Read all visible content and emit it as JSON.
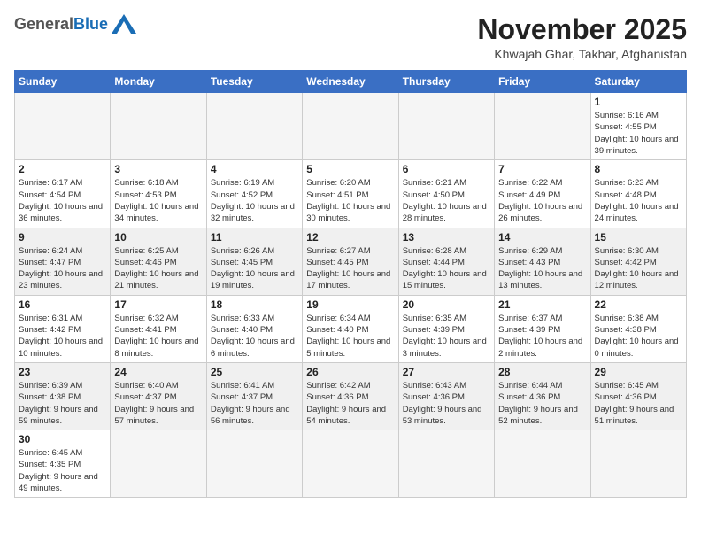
{
  "logo": {
    "general": "General",
    "blue": "Blue"
  },
  "header": {
    "month": "November 2025",
    "location": "Khwajah Ghar, Takhar, Afghanistan"
  },
  "weekdays": [
    "Sunday",
    "Monday",
    "Tuesday",
    "Wednesday",
    "Thursday",
    "Friday",
    "Saturday"
  ],
  "days": [
    {
      "date": "",
      "info": ""
    },
    {
      "date": "",
      "info": ""
    },
    {
      "date": "",
      "info": ""
    },
    {
      "date": "",
      "info": ""
    },
    {
      "date": "",
      "info": ""
    },
    {
      "date": "",
      "info": ""
    },
    {
      "date": "1",
      "info": "Sunrise: 6:16 AM\nSunset: 4:55 PM\nDaylight: 10 hours and 39 minutes."
    },
    {
      "date": "2",
      "info": "Sunrise: 6:17 AM\nSunset: 4:54 PM\nDaylight: 10 hours and 36 minutes."
    },
    {
      "date": "3",
      "info": "Sunrise: 6:18 AM\nSunset: 4:53 PM\nDaylight: 10 hours and 34 minutes."
    },
    {
      "date": "4",
      "info": "Sunrise: 6:19 AM\nSunset: 4:52 PM\nDaylight: 10 hours and 32 minutes."
    },
    {
      "date": "5",
      "info": "Sunrise: 6:20 AM\nSunset: 4:51 PM\nDaylight: 10 hours and 30 minutes."
    },
    {
      "date": "6",
      "info": "Sunrise: 6:21 AM\nSunset: 4:50 PM\nDaylight: 10 hours and 28 minutes."
    },
    {
      "date": "7",
      "info": "Sunrise: 6:22 AM\nSunset: 4:49 PM\nDaylight: 10 hours and 26 minutes."
    },
    {
      "date": "8",
      "info": "Sunrise: 6:23 AM\nSunset: 4:48 PM\nDaylight: 10 hours and 24 minutes."
    },
    {
      "date": "9",
      "info": "Sunrise: 6:24 AM\nSunset: 4:47 PM\nDaylight: 10 hours and 23 minutes."
    },
    {
      "date": "10",
      "info": "Sunrise: 6:25 AM\nSunset: 4:46 PM\nDaylight: 10 hours and 21 minutes."
    },
    {
      "date": "11",
      "info": "Sunrise: 6:26 AM\nSunset: 4:45 PM\nDaylight: 10 hours and 19 minutes."
    },
    {
      "date": "12",
      "info": "Sunrise: 6:27 AM\nSunset: 4:45 PM\nDaylight: 10 hours and 17 minutes."
    },
    {
      "date": "13",
      "info": "Sunrise: 6:28 AM\nSunset: 4:44 PM\nDaylight: 10 hours and 15 minutes."
    },
    {
      "date": "14",
      "info": "Sunrise: 6:29 AM\nSunset: 4:43 PM\nDaylight: 10 hours and 13 minutes."
    },
    {
      "date": "15",
      "info": "Sunrise: 6:30 AM\nSunset: 4:42 PM\nDaylight: 10 hours and 12 minutes."
    },
    {
      "date": "16",
      "info": "Sunrise: 6:31 AM\nSunset: 4:42 PM\nDaylight: 10 hours and 10 minutes."
    },
    {
      "date": "17",
      "info": "Sunrise: 6:32 AM\nSunset: 4:41 PM\nDaylight: 10 hours and 8 minutes."
    },
    {
      "date": "18",
      "info": "Sunrise: 6:33 AM\nSunset: 4:40 PM\nDaylight: 10 hours and 6 minutes."
    },
    {
      "date": "19",
      "info": "Sunrise: 6:34 AM\nSunset: 4:40 PM\nDaylight: 10 hours and 5 minutes."
    },
    {
      "date": "20",
      "info": "Sunrise: 6:35 AM\nSunset: 4:39 PM\nDaylight: 10 hours and 3 minutes."
    },
    {
      "date": "21",
      "info": "Sunrise: 6:37 AM\nSunset: 4:39 PM\nDaylight: 10 hours and 2 minutes."
    },
    {
      "date": "22",
      "info": "Sunrise: 6:38 AM\nSunset: 4:38 PM\nDaylight: 10 hours and 0 minutes."
    },
    {
      "date": "23",
      "info": "Sunrise: 6:39 AM\nSunset: 4:38 PM\nDaylight: 9 hours and 59 minutes."
    },
    {
      "date": "24",
      "info": "Sunrise: 6:40 AM\nSunset: 4:37 PM\nDaylight: 9 hours and 57 minutes."
    },
    {
      "date": "25",
      "info": "Sunrise: 6:41 AM\nSunset: 4:37 PM\nDaylight: 9 hours and 56 minutes."
    },
    {
      "date": "26",
      "info": "Sunrise: 6:42 AM\nSunset: 4:36 PM\nDaylight: 9 hours and 54 minutes."
    },
    {
      "date": "27",
      "info": "Sunrise: 6:43 AM\nSunset: 4:36 PM\nDaylight: 9 hours and 53 minutes."
    },
    {
      "date": "28",
      "info": "Sunrise: 6:44 AM\nSunset: 4:36 PM\nDaylight: 9 hours and 52 minutes."
    },
    {
      "date": "29",
      "info": "Sunrise: 6:45 AM\nSunset: 4:36 PM\nDaylight: 9 hours and 51 minutes."
    },
    {
      "date": "30",
      "info": "Sunrise: 6:45 AM\nSunset: 4:35 PM\nDaylight: 9 hours and 49 minutes."
    }
  ]
}
